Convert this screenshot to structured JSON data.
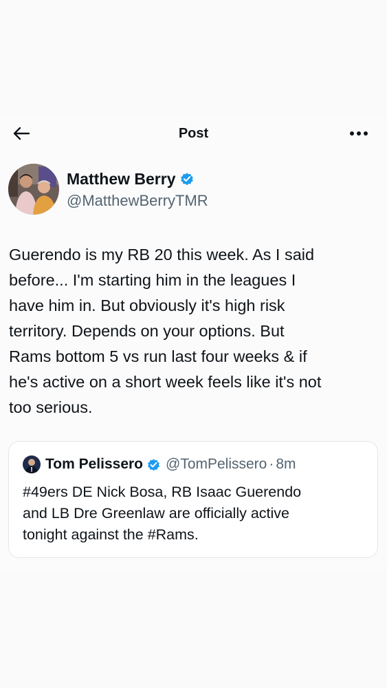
{
  "header": {
    "title": "Post",
    "back_icon": "arrow-left-icon",
    "more_icon": "more-horizontal-icon"
  },
  "author": {
    "name": "Matthew Berry",
    "handle": "@MatthewBerryTMR",
    "verified_icon": "verified-badge-icon",
    "verified_color": "#1d9bf0"
  },
  "tweet": {
    "text": "Guerendo is my RB 20 this week. As I said\nbefore... I'm starting him in the leagues I\nhave him in. But obviously it's high risk\nterritory. Depends on your options. But\nRams bottom 5 vs run last four weeks & if\nhe's active on a short week feels like it's not\ntoo serious."
  },
  "quote": {
    "name": "Tom Pelissero",
    "handle": "@TomPelissero",
    "separator": "·",
    "time": "8m",
    "text": "#49ers DE Nick Bosa, RB Isaac Guerendo\nand LB Dre Greenlaw are officially active\ntonight against the #Rams."
  }
}
